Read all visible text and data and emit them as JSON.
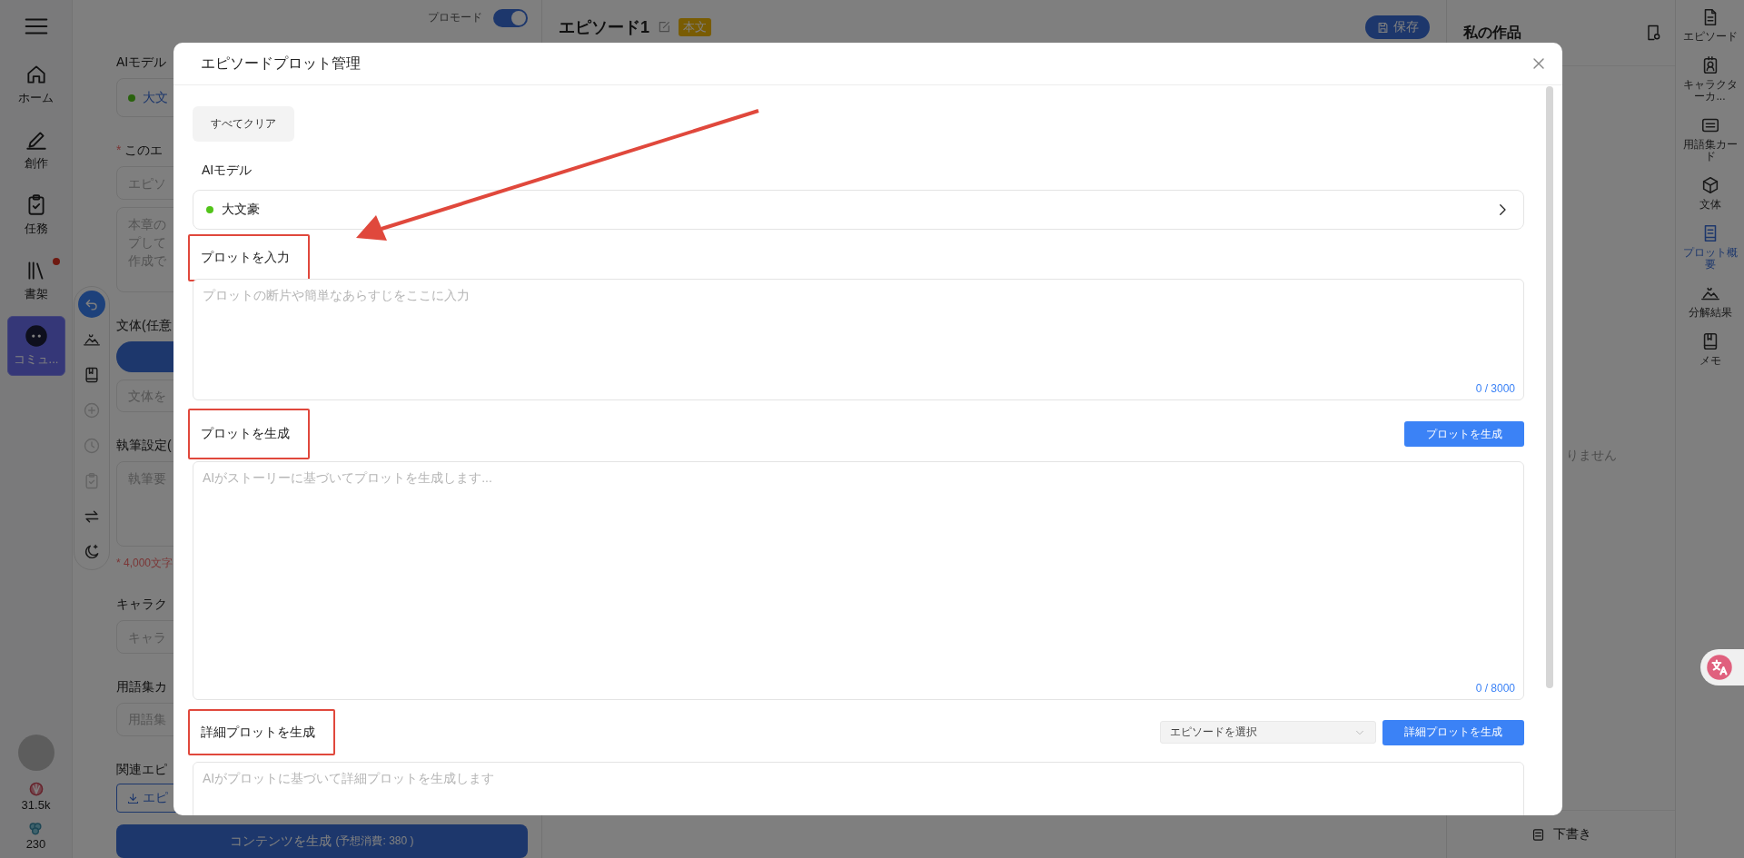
{
  "nav_rail": {
    "items": [
      {
        "label": "ホーム",
        "selected": false,
        "notification": false
      },
      {
        "label": "創作",
        "selected": false,
        "notification": false
      },
      {
        "label": "任務",
        "selected": false,
        "notification": false
      },
      {
        "label": "書架",
        "selected": false,
        "notification": true
      },
      {
        "label": "コミュ...",
        "selected": true,
        "notification": false
      }
    ],
    "stats": [
      {
        "value": "31.5k"
      },
      {
        "value": "230"
      }
    ]
  },
  "tool_strip": {
    "tools": [
      {
        "selected": true,
        "disabled": false
      },
      {
        "selected": false,
        "disabled": false
      },
      {
        "selected": false,
        "disabled": false
      },
      {
        "selected": false,
        "disabled": true
      },
      {
        "selected": false,
        "disabled": true
      },
      {
        "selected": false,
        "disabled": true
      },
      {
        "selected": false,
        "disabled": false
      },
      {
        "selected": false,
        "disabled": false
      }
    ]
  },
  "generation_form": {
    "pro_mode": {
      "label": "プロモード",
      "on": true
    },
    "fields": [
      {
        "kind": "label",
        "text": "AIモデル"
      },
      {
        "kind": "model",
        "value": "大文"
      },
      {
        "kind": "label",
        "marker": "*",
        "text": "このエ"
      },
      {
        "kind": "input",
        "placeholder": "エピソ"
      },
      {
        "kind": "textarea",
        "lines": [
          "本章の",
          "プして",
          "作成で"
        ]
      },
      {
        "kind": "label",
        "text": "文体(任意"
      },
      {
        "kind": "pill"
      },
      {
        "kind": "input",
        "placeholder": "文体を"
      },
      {
        "kind": "label",
        "text": "執筆設定("
      },
      {
        "kind": "textarea",
        "lines": [
          "執筆要"
        ]
      },
      {
        "kind": "note",
        "text": "* 4,000文字"
      },
      {
        "kind": "label",
        "text": "キャラク"
      },
      {
        "kind": "input",
        "placeholder": "キャラ"
      },
      {
        "kind": "label",
        "text": "用語集カ"
      },
      {
        "kind": "input",
        "placeholder": "用語集"
      },
      {
        "kind": "label",
        "text": "関連エピ"
      },
      {
        "kind": "button",
        "text": "エピ"
      }
    ],
    "submit": {
      "label": "コンテンツを生成",
      "cost": "(予想消費: 380 )"
    }
  },
  "editor": {
    "title": "エピソード1",
    "badge": "本文",
    "save_button": "保存"
  },
  "works_panel": {
    "title": "私の作品",
    "empty_text": "りません",
    "footer_button": "下書き"
  },
  "side_rail": {
    "items": [
      {
        "label": "エピソード",
        "selected": false
      },
      {
        "label": "キャラクターカ...",
        "selected": false
      },
      {
        "label": "用語集カード",
        "selected": false
      },
      {
        "label": "文体",
        "selected": false
      },
      {
        "label": "プロット概要",
        "selected": true
      },
      {
        "label": "分解結果",
        "selected": false
      },
      {
        "label": "メモ",
        "selected": false
      }
    ]
  },
  "plot_modal": {
    "title": "エピソードプロット管理",
    "clear_button": "すべてクリア",
    "sections": [
      {
        "kind": "model",
        "label": "AIモデル",
        "highlighted": false,
        "value": "大文豪"
      },
      {
        "kind": "input",
        "label": "プロットを入力",
        "highlighted": true,
        "placeholder": "プロットの断片や簡単なあらすじをここに入力",
        "counter": "0 / 3000"
      },
      {
        "kind": "generate",
        "label": "プロットを生成",
        "highlighted": true,
        "button": "プロットを生成",
        "placeholder": "AIがストーリーに基づいてプロットを生成します...",
        "counter": "0 / 8000"
      },
      {
        "kind": "detail",
        "label": "詳細プロットを生成",
        "highlighted": true,
        "select_placeholder": "エピソードを選択",
        "button": "詳細プロットを生成",
        "placeholder": "AIがプロットに基づいて詳細プロットを生成します"
      }
    ]
  }
}
